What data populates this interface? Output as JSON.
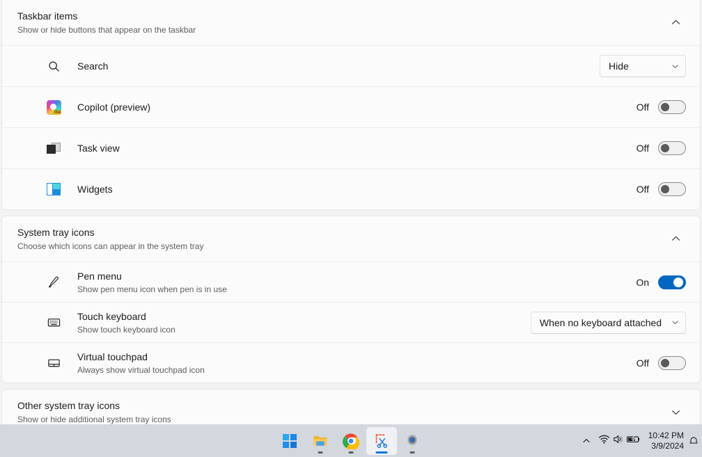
{
  "groups": [
    {
      "id": "taskbar-items",
      "title": "Taskbar items",
      "subtitle": "Show or hide buttons that appear on the taskbar",
      "expander_icon": "chevron-up-icon",
      "expanded": true,
      "rows": [
        {
          "id": "search",
          "icon": "search-icon",
          "title": "Search",
          "subtitle": "",
          "control": "combobox",
          "value": "Hide"
        },
        {
          "id": "copilot",
          "icon": "copilot-icon",
          "title": "Copilot (preview)",
          "subtitle": "",
          "control": "toggle",
          "state_label": "Off",
          "on": false
        },
        {
          "id": "task-view",
          "icon": "task-view-icon",
          "title": "Task view",
          "subtitle": "",
          "control": "toggle",
          "state_label": "Off",
          "on": false
        },
        {
          "id": "widgets",
          "icon": "widgets-icon",
          "title": "Widgets",
          "subtitle": "",
          "control": "toggle",
          "state_label": "Off",
          "on": false
        }
      ]
    },
    {
      "id": "system-tray-icons",
      "title": "System tray icons",
      "subtitle": "Choose which icons can appear in the system tray",
      "expander_icon": "chevron-up-icon",
      "expanded": true,
      "rows": [
        {
          "id": "pen-menu",
          "icon": "pen-icon",
          "title": "Pen menu",
          "subtitle": "Show pen menu icon when pen is in use",
          "control": "toggle",
          "state_label": "On",
          "on": true
        },
        {
          "id": "touch-keyboard",
          "icon": "keyboard-icon",
          "title": "Touch keyboard",
          "subtitle": "Show touch keyboard icon",
          "control": "combobox",
          "value": "When no keyboard attached"
        },
        {
          "id": "virtual-touchpad",
          "icon": "touchpad-icon",
          "title": "Virtual touchpad",
          "subtitle": "Always show virtual touchpad icon",
          "control": "toggle",
          "state_label": "Off",
          "on": false
        }
      ]
    },
    {
      "id": "other-system-tray-icons",
      "title": "Other system tray icons",
      "subtitle": "Show or hide additional system tray icons",
      "expander_icon": "chevron-down-icon",
      "expanded": false,
      "rows": []
    }
  ],
  "taskbar": {
    "apps": [
      {
        "id": "start",
        "name": "start-button",
        "active": false,
        "running": false
      },
      {
        "id": "file-explorer",
        "name": "file-explorer-button",
        "active": false,
        "running": true
      },
      {
        "id": "chrome",
        "name": "chrome-button",
        "active": false,
        "running": true
      },
      {
        "id": "snipping-tool",
        "name": "snipping-tool-button",
        "active": true,
        "running": true
      },
      {
        "id": "settings",
        "name": "settings-button",
        "active": false,
        "running": true
      }
    ],
    "tray": {
      "overflow_icon": "chevron-up-icon",
      "network_icon": "wifi-icon",
      "volume_icon": "speaker-icon",
      "battery_icon": "battery-charging-icon",
      "notification_icon": "bell-icon"
    },
    "clock": {
      "time": "10:42 PM",
      "date": "3/9/2024"
    }
  },
  "colors": {
    "accent": "#0067c0",
    "page_background": "#f3f3f3",
    "card_background": "#fbfbfb",
    "taskbar_background": "#d3d7de",
    "text_primary": "#1b1b1b",
    "text_secondary": "#5d5d5d"
  }
}
